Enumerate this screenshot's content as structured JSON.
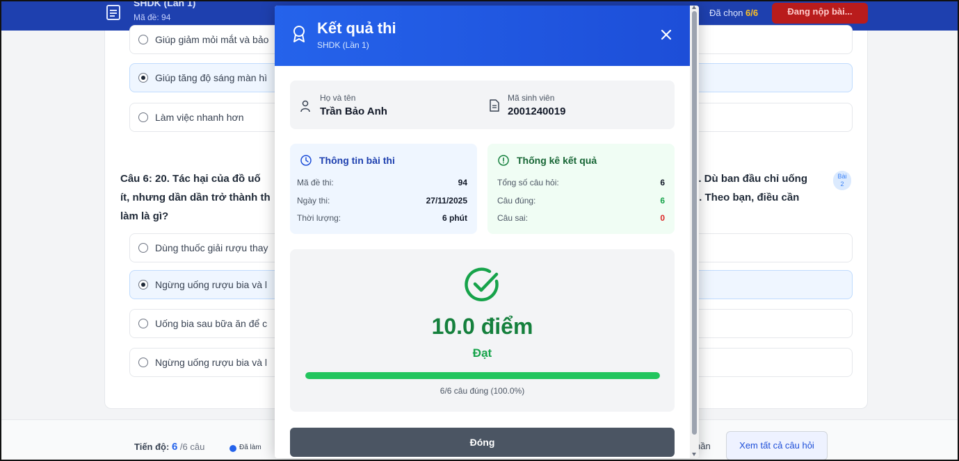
{
  "background": {
    "header": {
      "exam_title": "SHDK (Lần 1)",
      "exam_code": "Mã đề: 94",
      "selected_prefix": "Đã chọn",
      "selected_count": "6/6",
      "submit_label": "Đang nộp bài..."
    },
    "prev_options": [
      {
        "text": "Giúp giảm mỏi mắt và bảo",
        "selected": false
      },
      {
        "text": "Giúp tăng độ sáng màn hì",
        "selected": true
      },
      {
        "text": "Làm việc nhanh hơn",
        "selected": false
      }
    ],
    "question": {
      "left_text": "Câu 6: 20. Tác hại của đồ uống ít, nhưng dần dần trở thành th làm là gì?",
      "line1_left": "Câu 6: 20. Tác hại của đồ uố",
      "line2_left": "ít, nhưng dần dần trở thành th",
      "line3_left": "làm là gì?",
      "line1_right": "è. Dù ban đầu chỉ uống",
      "line2_right": "ủ. Theo bạn, điều cần",
      "badge_line1": "Bài",
      "badge_line2": "2"
    },
    "options": [
      {
        "text": "Dùng thuốc giải rượu thay",
        "selected": false
      },
      {
        "text": "Ngừng uống rượu bia và l",
        "selected": true
      },
      {
        "text": "Uống bia sau bữa ăn để c",
        "selected": false
      },
      {
        "text": "Ngừng uống rượu bia và l",
        "selected": false
      }
    ],
    "footer": {
      "progress_label": "Tiến độ:",
      "progress_count": "6",
      "progress_total": "/6 câu",
      "legend_done": "Đã làm",
      "part_label": "hần",
      "view_all_label": "Xem tất cả câu hỏi"
    }
  },
  "modal": {
    "title": "Kết quả thi",
    "subtitle": "SHDK (Lần 1)",
    "student": {
      "name_label": "Họ và tên",
      "name_value": "Trần Bảo Anh",
      "id_label": "Mã sinh viên",
      "id_value": "2001240019"
    },
    "exam_info": {
      "title": "Thông tin bài thi",
      "rows": [
        {
          "label": "Mã đề thi:",
          "value": "94"
        },
        {
          "label": "Ngày thi:",
          "value": "27/11/2025"
        },
        {
          "label": "Thời lượng:",
          "value": "6 phút"
        }
      ]
    },
    "stats": {
      "title": "Thống kê kết quả",
      "rows": [
        {
          "label": "Tổng số câu hỏi:",
          "value": "6",
          "color": "#111827"
        },
        {
          "label": "Câu đúng:",
          "value": "6",
          "color": "#16a34a"
        },
        {
          "label": "Câu sai:",
          "value": "0",
          "color": "#dc2626"
        }
      ]
    },
    "result": {
      "score_text": "10.0 điểm",
      "status": "Đạt",
      "progress_percent": 100,
      "summary": "6/6 câu đúng (100.0%)"
    },
    "close_label": "Đóng"
  },
  "colors": {
    "primary": "#2563eb",
    "success": "#16a34a",
    "danger": "#dc2626"
  }
}
